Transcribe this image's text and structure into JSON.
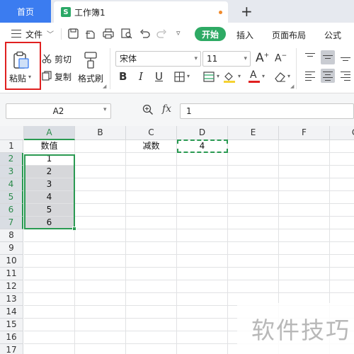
{
  "tabs": {
    "home_label": "首页",
    "doc_label": "工作簿1",
    "doc_icon": "S",
    "new_tab": "+"
  },
  "menu": {
    "file_label": "文件",
    "start_label": "开始",
    "insert_label": "插入",
    "layout_label": "页面布局",
    "formula_label": "公式"
  },
  "ribbon": {
    "paste_label": "粘贴",
    "cut_label": "剪切",
    "copy_label": "复制",
    "format_painter_label": "格式刷",
    "font_name": "宋体",
    "font_size": "11",
    "grow_font": "A",
    "shrink_font": "A",
    "bold": "B",
    "italic": "I",
    "underline": "U",
    "font_color_letter": "A",
    "font_color": "#e02020",
    "fill_color": "#f5d232"
  },
  "formula_bar": {
    "name_box": "A2",
    "fx_label": "fx",
    "formula_value": "1"
  },
  "grid": {
    "columns": [
      "A",
      "B",
      "C",
      "D",
      "E",
      "F",
      "G"
    ],
    "rows": [
      "1",
      "2",
      "3",
      "4",
      "5",
      "6",
      "7",
      "8",
      "9",
      "10",
      "11",
      "12",
      "13",
      "14",
      "15",
      "16",
      "17"
    ],
    "cells": {
      "A1": "数值",
      "A2": "1",
      "A3": "2",
      "A4": "3",
      "A5": "4",
      "A6": "5",
      "A7": "6",
      "C1": "减数",
      "D1": "4"
    },
    "selected_range": "A2:A7",
    "copy_range": "D1",
    "accent_color": "#2a9a52"
  },
  "watermark": "软件技巧"
}
